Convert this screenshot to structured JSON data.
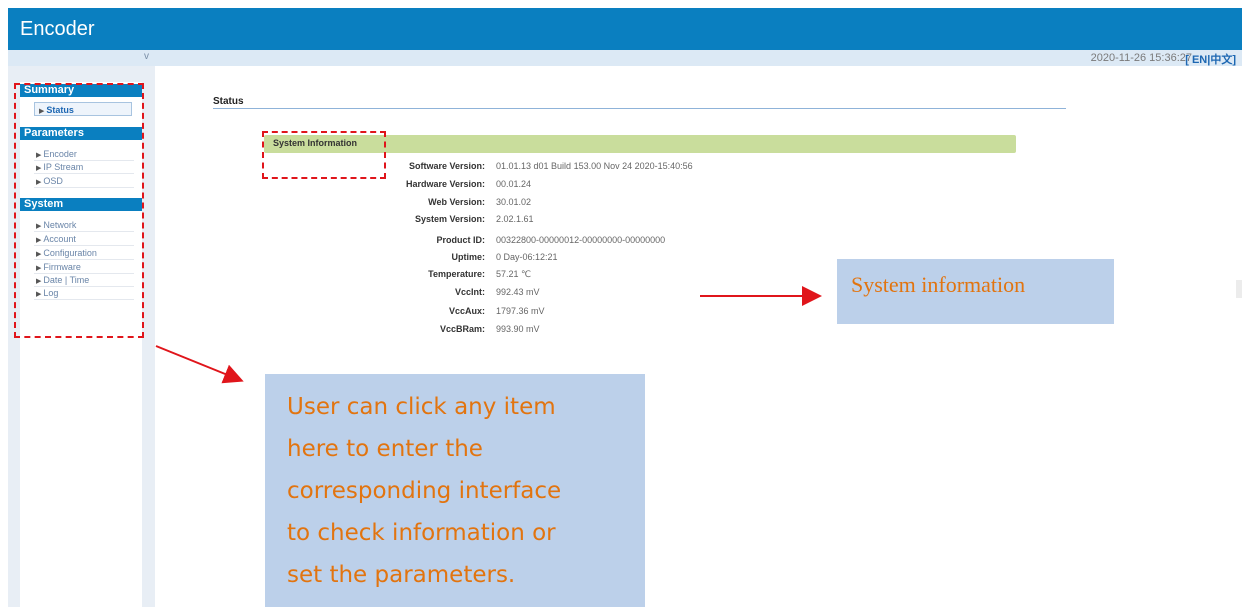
{
  "header": {
    "title": "Encoder"
  },
  "subbar": {
    "collapse_icon": "v",
    "datetime": "2020-11-26 15:36:27",
    "lang_open": "[",
    "lang_en": "EN",
    "lang_sep": "|",
    "lang_cn": "中文",
    "lang_close": "]"
  },
  "sidebar": {
    "sections": [
      {
        "title": "Summary",
        "items": [
          {
            "label": "Status"
          }
        ]
      },
      {
        "title": "Parameters",
        "items": [
          {
            "label": "Encoder"
          },
          {
            "label": "IP Stream"
          },
          {
            "label": "OSD"
          }
        ]
      },
      {
        "title": "System",
        "items": [
          {
            "label": "Network"
          },
          {
            "label": "Account"
          },
          {
            "label": "Configuration"
          },
          {
            "label": "Firmware"
          },
          {
            "label": "Date | Time"
          },
          {
            "label": "Log"
          }
        ]
      }
    ]
  },
  "main": {
    "page_title": "Status",
    "section_title": "System Information",
    "rows": [
      {
        "label": "Software Version:",
        "value": "01.01.13 d01 Build 153.00 Nov 24 2020-15:40:56"
      },
      {
        "label": "Hardware Version:",
        "value": "00.01.24"
      },
      {
        "label": "Web Version:",
        "value": "30.01.02"
      },
      {
        "label": "System Version:",
        "value": "2.02.1.61"
      },
      {
        "label": "Product ID:",
        "value": "00322800-00000012-00000000-00000000"
      },
      {
        "label": "Uptime:",
        "value": "0 Day-06:12:21"
      },
      {
        "label": "Temperature:",
        "value": "57.21 ℃"
      },
      {
        "label": "VccInt:",
        "value": "992.43 mV"
      },
      {
        "label": "VccAux:",
        "value": "1797.36 mV"
      },
      {
        "label": "VccBRam:",
        "value": "993.90 mV"
      }
    ]
  },
  "annotations": {
    "system_info_callout": "System information",
    "sidebar_callout_lines": [
      "User can click any item",
      "here to enter the",
      "corresponding interface",
      "to check information or",
      "set the parameters."
    ]
  },
  "colors": {
    "header_bg": "#0a7fc0",
    "section_bar": "#c9dd9c",
    "annotation_red": "#e0151b",
    "annotation_text": "#e2740f",
    "callout_bg": "#bcd0ea"
  }
}
